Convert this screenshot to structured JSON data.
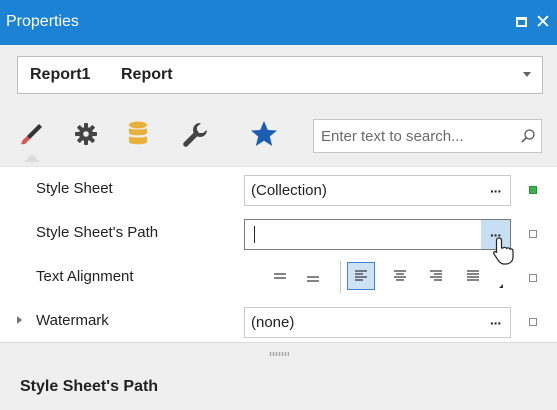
{
  "titlebar": {
    "title": "Properties",
    "maximize_icon": "maximize-icon",
    "close_glyph": "✕"
  },
  "selector": {
    "object_name": "Report1",
    "object_type": "Report"
  },
  "toolbar": {
    "tabs": [
      {
        "icon": "brush-icon",
        "color": "#d9534f",
        "active": true
      },
      {
        "icon": "gear-icon",
        "color": "#444444"
      },
      {
        "icon": "database-icon",
        "color": "#e8b23a"
      },
      {
        "icon": "wrench-icon",
        "color": "#444444"
      },
      {
        "icon": "star-icon",
        "color": "#1b5fb5"
      }
    ],
    "search_placeholder": "Enter text to search..."
  },
  "properties": [
    {
      "label": "Style Sheet",
      "value": "(Collection)",
      "button": "···",
      "modified": true
    },
    {
      "label": "Style Sheet's Path",
      "value": "",
      "button": "···",
      "modified": false
    },
    {
      "label": "Text Alignment",
      "modified": false
    },
    {
      "label": "Watermark",
      "value": "(none)",
      "button": "···",
      "modified": false,
      "expandable": true
    }
  ],
  "description": {
    "title": "Style Sheet's Path"
  },
  "colors": {
    "accent": "#1c82d4",
    "modified_marker": "#39b54a",
    "hot_button": "#c7dff3",
    "selected_align": "#cfe2f5"
  }
}
